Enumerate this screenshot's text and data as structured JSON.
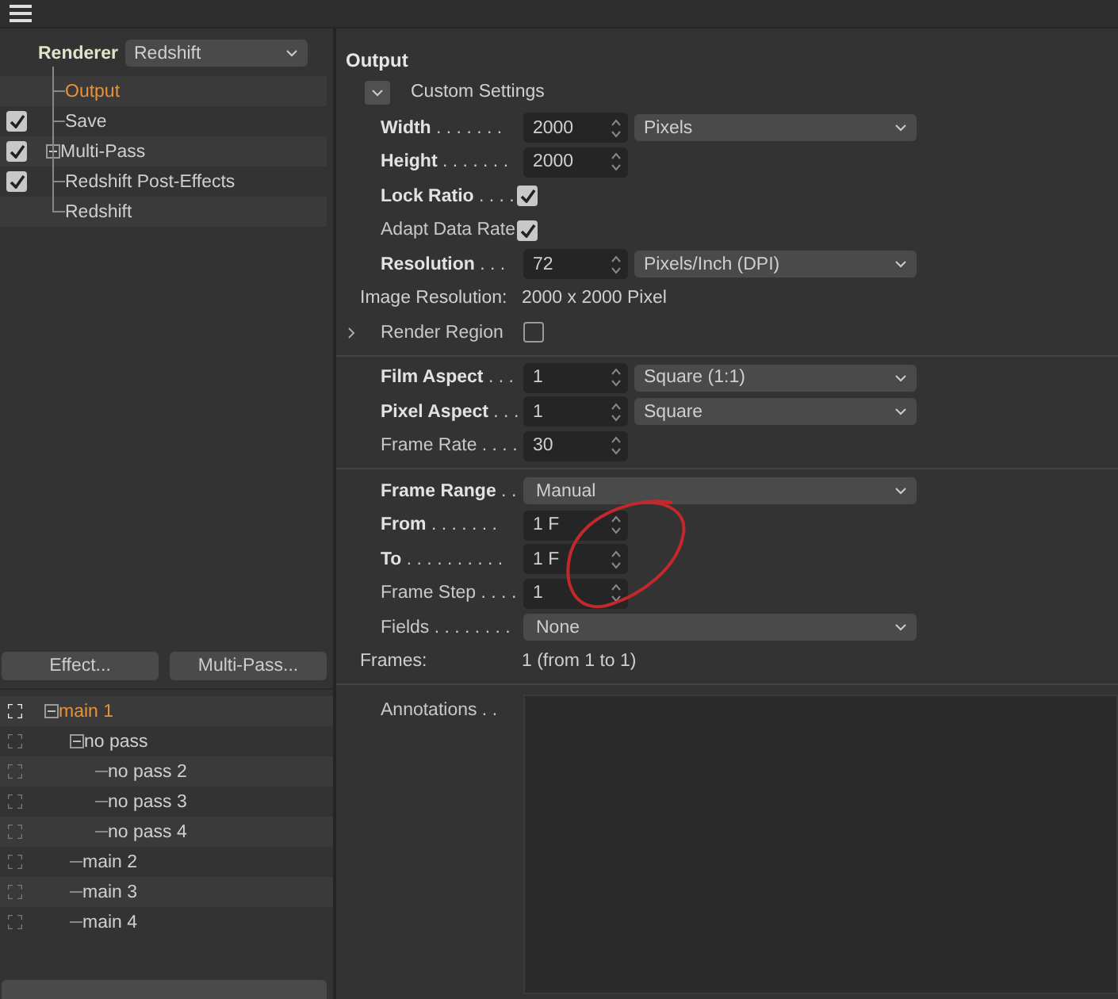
{
  "renderer": {
    "label": "Renderer",
    "value": "Redshift"
  },
  "settings_tree": [
    {
      "label": "Output",
      "kind": "plain",
      "selected": true
    },
    {
      "label": "Save",
      "kind": "check",
      "checked": true,
      "selected": false
    },
    {
      "label": "Multi-Pass",
      "kind": "check",
      "checked": true,
      "expanded": false,
      "selected": false
    },
    {
      "label": "Redshift Post-Effects",
      "kind": "check",
      "checked": true,
      "selected": false
    },
    {
      "label": "Redshift",
      "kind": "plain",
      "selected": false
    }
  ],
  "buttons": [
    "Effect...",
    "Multi-Pass..."
  ],
  "pass_tree": [
    {
      "label": "main 1",
      "selected": true,
      "expanded": true,
      "children": [
        {
          "label": "no pass",
          "selected": false,
          "expanded": true,
          "children": [
            {
              "label": "no pass 2",
              "selected": false
            },
            {
              "label": "no pass 3",
              "selected": false
            },
            {
              "label": "no pass 4",
              "selected": false
            }
          ]
        },
        {
          "label": "main 2",
          "selected": false
        },
        {
          "label": "main 3",
          "selected": false
        },
        {
          "label": "main 4",
          "selected": false
        }
      ]
    }
  ],
  "output": {
    "title": "Output",
    "preset": "Custom Settings",
    "sections": [
      [
        {
          "kind": "number",
          "label": "**Width** . . . . . . .",
          "value": "2000",
          "unit": "Pixels"
        },
        {
          "kind": "number",
          "label": "**Height** . . . . . . .",
          "value": "2000"
        },
        {
          "kind": "check",
          "label": "**Lock Ratio** . . . .",
          "checked": true
        },
        {
          "kind": "check",
          "label": "Adapt Data Rate",
          "checked": true
        },
        {
          "kind": "number",
          "label": "**Resolution** . . .",
          "value": "72",
          "unit": "Pixels/Inch (DPI)"
        },
        {
          "kind": "info",
          "label": "Image Resolution:",
          "value": "2000 x 2000 Pixel"
        },
        {
          "kind": "toggle",
          "label": "Render Region",
          "checked": false
        }
      ],
      [
        {
          "kind": "number",
          "label": "**Film Aspect** . . .",
          "value": "1",
          "unit": "Square (1:1)"
        },
        {
          "kind": "number",
          "label": "**Pixel Aspect** . . .",
          "value": "1",
          "unit": "Square"
        },
        {
          "kind": "number",
          "label": "Frame Rate . . . .",
          "value": "30"
        }
      ],
      [
        {
          "kind": "select",
          "label": "**Frame Range** . .",
          "value": "Manual"
        },
        {
          "kind": "number",
          "label": "**From** . . . . . . .",
          "value": "1 F"
        },
        {
          "kind": "number",
          "label": "**To** . . . . . . . . . .",
          "value": "1 F"
        },
        {
          "kind": "number",
          "label": "Frame Step . . . .",
          "value": "1"
        },
        {
          "kind": "select",
          "label": "Fields . . . . . . . .",
          "value": "None"
        },
        {
          "kind": "info",
          "label": "Frames:",
          "value": "1 (from 1 to 1)"
        }
      ],
      [
        {
          "kind": "notes",
          "label": "Annotations . ."
        }
      ]
    ]
  }
}
